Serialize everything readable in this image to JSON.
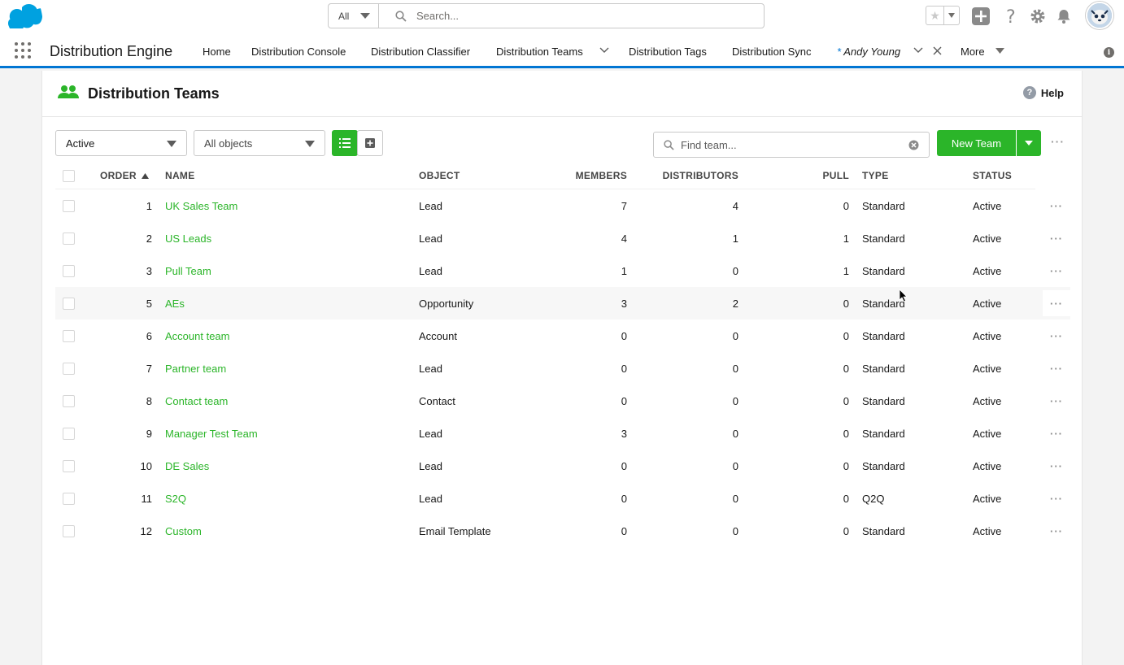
{
  "global_header": {
    "search_scope": "All",
    "search_placeholder": "Search..."
  },
  "nav": {
    "app_name": "Distribution Engine",
    "items": [
      {
        "label": "Home"
      },
      {
        "label": "Distribution Console"
      },
      {
        "label": "Distribution Classifier"
      },
      {
        "label": "Distribution Teams"
      },
      {
        "label": "Distribution Tags"
      },
      {
        "label": "Distribution Sync"
      },
      {
        "label": "Andy Young",
        "prefix": "*"
      },
      {
        "label": "More"
      }
    ]
  },
  "page": {
    "title": "Distribution Teams",
    "help_label": "Help"
  },
  "toolbar": {
    "status_filter": "Active",
    "object_filter": "All objects",
    "find_placeholder": "Find team...",
    "new_team_label": "New Team"
  },
  "table": {
    "columns": [
      "ORDER",
      "NAME",
      "OBJECT",
      "MEMBERS",
      "DISTRIBUTORS",
      "PULL",
      "TYPE",
      "STATUS"
    ],
    "rows": [
      {
        "order": "1",
        "name": "UK Sales Team",
        "object": "Lead",
        "members": "7",
        "distributors": "4",
        "pull": "0",
        "type": "Standard",
        "status": "Active"
      },
      {
        "order": "2",
        "name": "US Leads",
        "object": "Lead",
        "members": "4",
        "distributors": "1",
        "pull": "1",
        "type": "Standard",
        "status": "Active"
      },
      {
        "order": "3",
        "name": "Pull Team",
        "object": "Lead",
        "members": "1",
        "distributors": "0",
        "pull": "1",
        "type": "Standard",
        "status": "Active"
      },
      {
        "order": "5",
        "name": "AEs",
        "object": "Opportunity",
        "members": "3",
        "distributors": "2",
        "pull": "0",
        "type": "Standard",
        "status": "Active"
      },
      {
        "order": "6",
        "name": "Account team",
        "object": "Account",
        "members": "0",
        "distributors": "0",
        "pull": "0",
        "type": "Standard",
        "status": "Active"
      },
      {
        "order": "7",
        "name": "Partner team",
        "object": "Lead",
        "members": "0",
        "distributors": "0",
        "pull": "0",
        "type": "Standard",
        "status": "Active"
      },
      {
        "order": "8",
        "name": "Contact team",
        "object": "Contact",
        "members": "0",
        "distributors": "0",
        "pull": "0",
        "type": "Standard",
        "status": "Active"
      },
      {
        "order": "9",
        "name": "Manager Test Team",
        "object": "Lead",
        "members": "3",
        "distributors": "0",
        "pull": "0",
        "type": "Standard",
        "status": "Active"
      },
      {
        "order": "10",
        "name": "DE Sales",
        "object": "Lead",
        "members": "0",
        "distributors": "0",
        "pull": "0",
        "type": "Standard",
        "status": "Active"
      },
      {
        "order": "11",
        "name": "S2Q",
        "object": "Lead",
        "members": "0",
        "distributors": "0",
        "pull": "0",
        "type": "Q2Q",
        "status": "Active"
      },
      {
        "order": "12",
        "name": "Custom",
        "object": "Email Template",
        "members": "0",
        "distributors": "0",
        "pull": "0",
        "type": "Standard",
        "status": "Active"
      }
    ]
  },
  "colors": {
    "accent_green": "#2bb529",
    "nav_blue": "#0176d3",
    "salesforce_blue": "#00a1e0"
  }
}
